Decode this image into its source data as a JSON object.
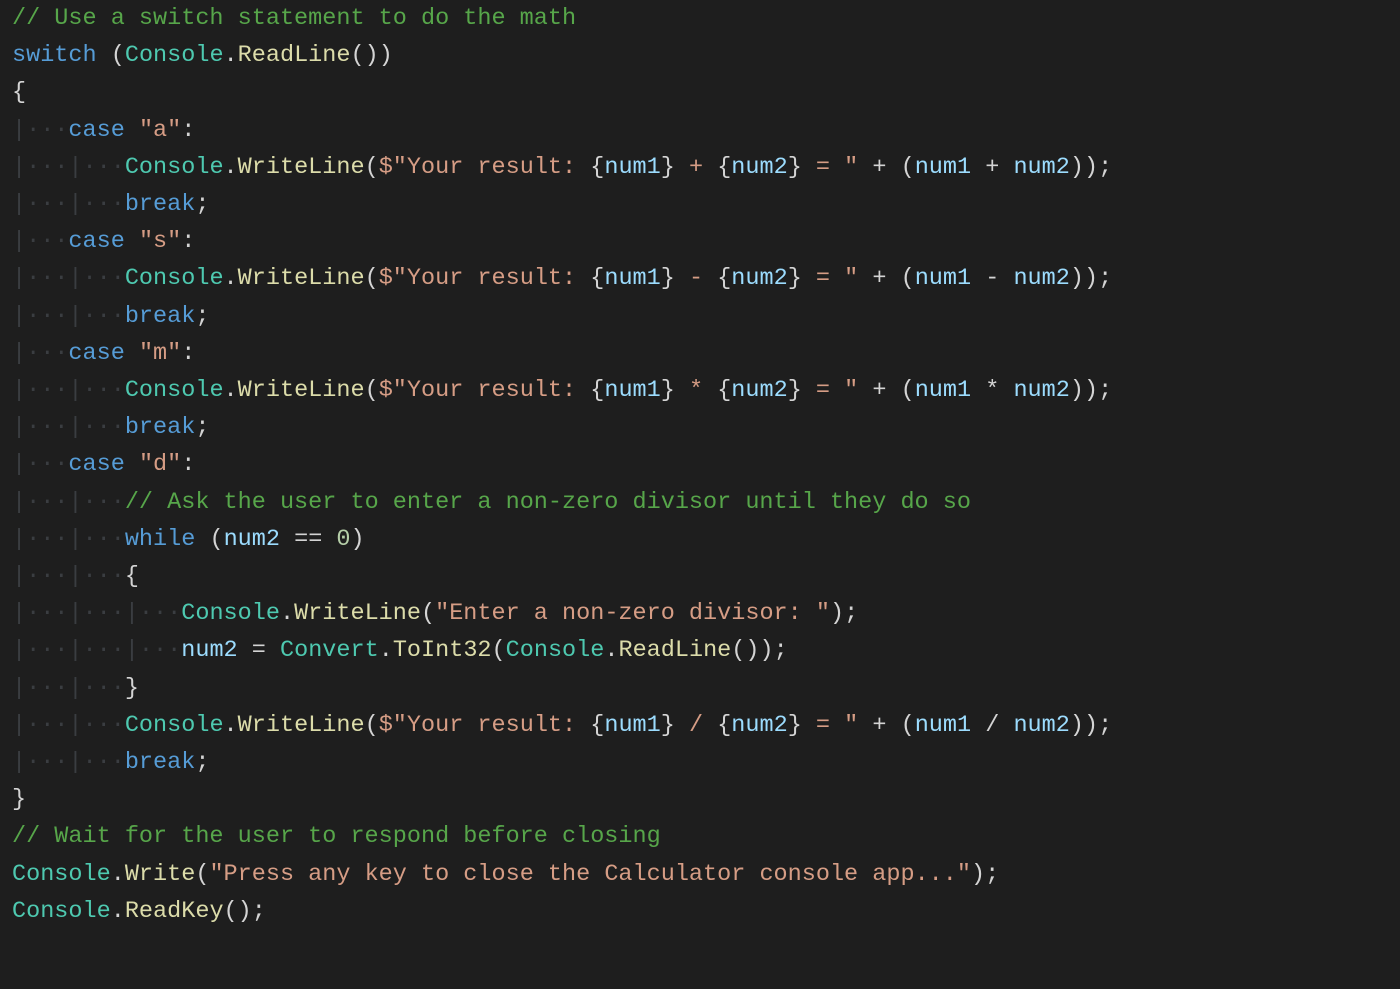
{
  "code": {
    "lines": [
      {
        "indent": 0,
        "guides": "",
        "segments": [
          {
            "cls": "c-comment",
            "text": "// Use a switch statement to do the math"
          }
        ]
      },
      {
        "indent": 0,
        "guides": "",
        "segments": [
          {
            "cls": "c-keyword",
            "text": "switch"
          },
          {
            "cls": "c-plain",
            "text": " "
          },
          {
            "cls": "c-punct",
            "text": "("
          },
          {
            "cls": "c-type",
            "text": "Console"
          },
          {
            "cls": "c-punct",
            "text": "."
          },
          {
            "cls": "c-method",
            "text": "ReadLine"
          },
          {
            "cls": "c-punct",
            "text": "())"
          }
        ]
      },
      {
        "indent": 0,
        "guides": "",
        "segments": [
          {
            "cls": "c-punct",
            "text": "{"
          }
        ]
      },
      {
        "indent": 1,
        "guides": "|···",
        "segments": [
          {
            "cls": "c-keyword",
            "text": "case"
          },
          {
            "cls": "c-plain",
            "text": " "
          },
          {
            "cls": "c-string",
            "text": "\"a\""
          },
          {
            "cls": "c-punct",
            "text": ":"
          }
        ]
      },
      {
        "indent": 2,
        "guides": "|···|···",
        "segments": [
          {
            "cls": "c-type",
            "text": "Console"
          },
          {
            "cls": "c-punct",
            "text": "."
          },
          {
            "cls": "c-method",
            "text": "WriteLine"
          },
          {
            "cls": "c-punct",
            "text": "("
          },
          {
            "cls": "c-string",
            "text": "$\"Your result: "
          },
          {
            "cls": "c-punct",
            "text": "{"
          },
          {
            "cls": "c-ident",
            "text": "num1"
          },
          {
            "cls": "c-punct",
            "text": "}"
          },
          {
            "cls": "c-string",
            "text": " + "
          },
          {
            "cls": "c-punct",
            "text": "{"
          },
          {
            "cls": "c-ident",
            "text": "num2"
          },
          {
            "cls": "c-punct",
            "text": "}"
          },
          {
            "cls": "c-string",
            "text": " = \""
          },
          {
            "cls": "c-plain",
            "text": " "
          },
          {
            "cls": "c-punct",
            "text": "+"
          },
          {
            "cls": "c-plain",
            "text": " "
          },
          {
            "cls": "c-punct",
            "text": "("
          },
          {
            "cls": "c-ident",
            "text": "num1"
          },
          {
            "cls": "c-plain",
            "text": " "
          },
          {
            "cls": "c-punct",
            "text": "+"
          },
          {
            "cls": "c-plain",
            "text": " "
          },
          {
            "cls": "c-ident",
            "text": "num2"
          },
          {
            "cls": "c-punct",
            "text": "));"
          }
        ]
      },
      {
        "indent": 2,
        "guides": "|···|···",
        "segments": [
          {
            "cls": "c-keyword",
            "text": "break"
          },
          {
            "cls": "c-punct",
            "text": ";"
          }
        ]
      },
      {
        "indent": 1,
        "guides": "|···",
        "segments": [
          {
            "cls": "c-keyword",
            "text": "case"
          },
          {
            "cls": "c-plain",
            "text": " "
          },
          {
            "cls": "c-string",
            "text": "\"s\""
          },
          {
            "cls": "c-punct",
            "text": ":"
          }
        ]
      },
      {
        "indent": 2,
        "guides": "|···|···",
        "segments": [
          {
            "cls": "c-type",
            "text": "Console"
          },
          {
            "cls": "c-punct",
            "text": "."
          },
          {
            "cls": "c-method",
            "text": "WriteLine"
          },
          {
            "cls": "c-punct",
            "text": "("
          },
          {
            "cls": "c-string",
            "text": "$\"Your result: "
          },
          {
            "cls": "c-punct",
            "text": "{"
          },
          {
            "cls": "c-ident",
            "text": "num1"
          },
          {
            "cls": "c-punct",
            "text": "}"
          },
          {
            "cls": "c-string",
            "text": " - "
          },
          {
            "cls": "c-punct",
            "text": "{"
          },
          {
            "cls": "c-ident",
            "text": "num2"
          },
          {
            "cls": "c-punct",
            "text": "}"
          },
          {
            "cls": "c-string",
            "text": " = \""
          },
          {
            "cls": "c-plain",
            "text": " "
          },
          {
            "cls": "c-punct",
            "text": "+"
          },
          {
            "cls": "c-plain",
            "text": " "
          },
          {
            "cls": "c-punct",
            "text": "("
          },
          {
            "cls": "c-ident",
            "text": "num1"
          },
          {
            "cls": "c-plain",
            "text": " "
          },
          {
            "cls": "c-punct",
            "text": "-"
          },
          {
            "cls": "c-plain",
            "text": " "
          },
          {
            "cls": "c-ident",
            "text": "num2"
          },
          {
            "cls": "c-punct",
            "text": "));"
          }
        ]
      },
      {
        "indent": 2,
        "guides": "|···|···",
        "segments": [
          {
            "cls": "c-keyword",
            "text": "break"
          },
          {
            "cls": "c-punct",
            "text": ";"
          }
        ]
      },
      {
        "indent": 1,
        "guides": "|···",
        "segments": [
          {
            "cls": "c-keyword",
            "text": "case"
          },
          {
            "cls": "c-plain",
            "text": " "
          },
          {
            "cls": "c-string",
            "text": "\"m\""
          },
          {
            "cls": "c-punct",
            "text": ":"
          }
        ]
      },
      {
        "indent": 2,
        "guides": "|···|···",
        "segments": [
          {
            "cls": "c-type",
            "text": "Console"
          },
          {
            "cls": "c-punct",
            "text": "."
          },
          {
            "cls": "c-method",
            "text": "WriteLine"
          },
          {
            "cls": "c-punct",
            "text": "("
          },
          {
            "cls": "c-string",
            "text": "$\"Your result: "
          },
          {
            "cls": "c-punct",
            "text": "{"
          },
          {
            "cls": "c-ident",
            "text": "num1"
          },
          {
            "cls": "c-punct",
            "text": "}"
          },
          {
            "cls": "c-string",
            "text": " * "
          },
          {
            "cls": "c-punct",
            "text": "{"
          },
          {
            "cls": "c-ident",
            "text": "num2"
          },
          {
            "cls": "c-punct",
            "text": "}"
          },
          {
            "cls": "c-string",
            "text": " = \""
          },
          {
            "cls": "c-plain",
            "text": " "
          },
          {
            "cls": "c-punct",
            "text": "+"
          },
          {
            "cls": "c-plain",
            "text": " "
          },
          {
            "cls": "c-punct",
            "text": "("
          },
          {
            "cls": "c-ident",
            "text": "num1"
          },
          {
            "cls": "c-plain",
            "text": " "
          },
          {
            "cls": "c-punct",
            "text": "*"
          },
          {
            "cls": "c-plain",
            "text": " "
          },
          {
            "cls": "c-ident",
            "text": "num2"
          },
          {
            "cls": "c-punct",
            "text": "));"
          }
        ]
      },
      {
        "indent": 2,
        "guides": "|···|···",
        "segments": [
          {
            "cls": "c-keyword",
            "text": "break"
          },
          {
            "cls": "c-punct",
            "text": ";"
          }
        ]
      },
      {
        "indent": 1,
        "guides": "|···",
        "segments": [
          {
            "cls": "c-keyword",
            "text": "case"
          },
          {
            "cls": "c-plain",
            "text": " "
          },
          {
            "cls": "c-string",
            "text": "\"d\""
          },
          {
            "cls": "c-punct",
            "text": ":"
          }
        ]
      },
      {
        "indent": 2,
        "guides": "|···|···",
        "segments": [
          {
            "cls": "c-comment",
            "text": "// Ask the user to enter a non-zero divisor until they do so"
          }
        ]
      },
      {
        "indent": 2,
        "guides": "|···|···",
        "segments": [
          {
            "cls": "c-keyword",
            "text": "while"
          },
          {
            "cls": "c-plain",
            "text": " "
          },
          {
            "cls": "c-punct",
            "text": "("
          },
          {
            "cls": "c-ident",
            "text": "num2"
          },
          {
            "cls": "c-plain",
            "text": " "
          },
          {
            "cls": "c-punct",
            "text": "=="
          },
          {
            "cls": "c-plain",
            "text": " "
          },
          {
            "cls": "c-number",
            "text": "0"
          },
          {
            "cls": "c-punct",
            "text": ")"
          }
        ]
      },
      {
        "indent": 2,
        "guides": "|···|···",
        "segments": [
          {
            "cls": "c-punct",
            "text": "{"
          }
        ]
      },
      {
        "indent": 3,
        "guides": "|···|···|···",
        "segments": [
          {
            "cls": "c-type",
            "text": "Console"
          },
          {
            "cls": "c-punct",
            "text": "."
          },
          {
            "cls": "c-method",
            "text": "WriteLine"
          },
          {
            "cls": "c-punct",
            "text": "("
          },
          {
            "cls": "c-string",
            "text": "\"Enter a non-zero divisor: \""
          },
          {
            "cls": "c-punct",
            "text": ");"
          }
        ]
      },
      {
        "indent": 3,
        "guides": "|···|···|···",
        "segments": [
          {
            "cls": "c-ident",
            "text": "num2"
          },
          {
            "cls": "c-plain",
            "text": " "
          },
          {
            "cls": "c-punct",
            "text": "="
          },
          {
            "cls": "c-plain",
            "text": " "
          },
          {
            "cls": "c-type",
            "text": "Convert"
          },
          {
            "cls": "c-punct",
            "text": "."
          },
          {
            "cls": "c-method",
            "text": "ToInt32"
          },
          {
            "cls": "c-punct",
            "text": "("
          },
          {
            "cls": "c-type",
            "text": "Console"
          },
          {
            "cls": "c-punct",
            "text": "."
          },
          {
            "cls": "c-method",
            "text": "ReadLine"
          },
          {
            "cls": "c-punct",
            "text": "());"
          }
        ]
      },
      {
        "indent": 2,
        "guides": "|···|···",
        "segments": [
          {
            "cls": "c-punct",
            "text": "}"
          }
        ]
      },
      {
        "indent": 2,
        "guides": "|···|···",
        "segments": [
          {
            "cls": "c-type",
            "text": "Console"
          },
          {
            "cls": "c-punct",
            "text": "."
          },
          {
            "cls": "c-method",
            "text": "WriteLine"
          },
          {
            "cls": "c-punct",
            "text": "("
          },
          {
            "cls": "c-string",
            "text": "$\"Your result: "
          },
          {
            "cls": "c-punct",
            "text": "{"
          },
          {
            "cls": "c-ident",
            "text": "num1"
          },
          {
            "cls": "c-punct",
            "text": "}"
          },
          {
            "cls": "c-string",
            "text": " / "
          },
          {
            "cls": "c-punct",
            "text": "{"
          },
          {
            "cls": "c-ident",
            "text": "num2"
          },
          {
            "cls": "c-punct",
            "text": "}"
          },
          {
            "cls": "c-string",
            "text": " = \""
          },
          {
            "cls": "c-plain",
            "text": " "
          },
          {
            "cls": "c-punct",
            "text": "+"
          },
          {
            "cls": "c-plain",
            "text": " "
          },
          {
            "cls": "c-punct",
            "text": "("
          },
          {
            "cls": "c-ident",
            "text": "num1"
          },
          {
            "cls": "c-plain",
            "text": " "
          },
          {
            "cls": "c-punct",
            "text": "/"
          },
          {
            "cls": "c-plain",
            "text": " "
          },
          {
            "cls": "c-ident",
            "text": "num2"
          },
          {
            "cls": "c-punct",
            "text": "));"
          }
        ]
      },
      {
        "indent": 2,
        "guides": "|···|···",
        "segments": [
          {
            "cls": "c-keyword",
            "text": "break"
          },
          {
            "cls": "c-punct",
            "text": ";"
          }
        ]
      },
      {
        "indent": 0,
        "guides": "",
        "segments": [
          {
            "cls": "c-punct",
            "text": "}"
          }
        ]
      },
      {
        "indent": 0,
        "guides": "",
        "segments": [
          {
            "cls": "c-comment",
            "text": "// Wait for the user to respond before closing"
          }
        ]
      },
      {
        "indent": 0,
        "guides": "",
        "segments": [
          {
            "cls": "c-type",
            "text": "Console"
          },
          {
            "cls": "c-punct",
            "text": "."
          },
          {
            "cls": "c-method",
            "text": "Write"
          },
          {
            "cls": "c-punct",
            "text": "("
          },
          {
            "cls": "c-string",
            "text": "\"Press any key to close the Calculator console app...\""
          },
          {
            "cls": "c-punct",
            "text": ");"
          }
        ]
      },
      {
        "indent": 0,
        "guides": "",
        "segments": [
          {
            "cls": "c-type",
            "text": "Console"
          },
          {
            "cls": "c-punct",
            "text": "."
          },
          {
            "cls": "c-method",
            "text": "ReadKey"
          },
          {
            "cls": "c-punct",
            "text": "();"
          }
        ]
      }
    ]
  }
}
